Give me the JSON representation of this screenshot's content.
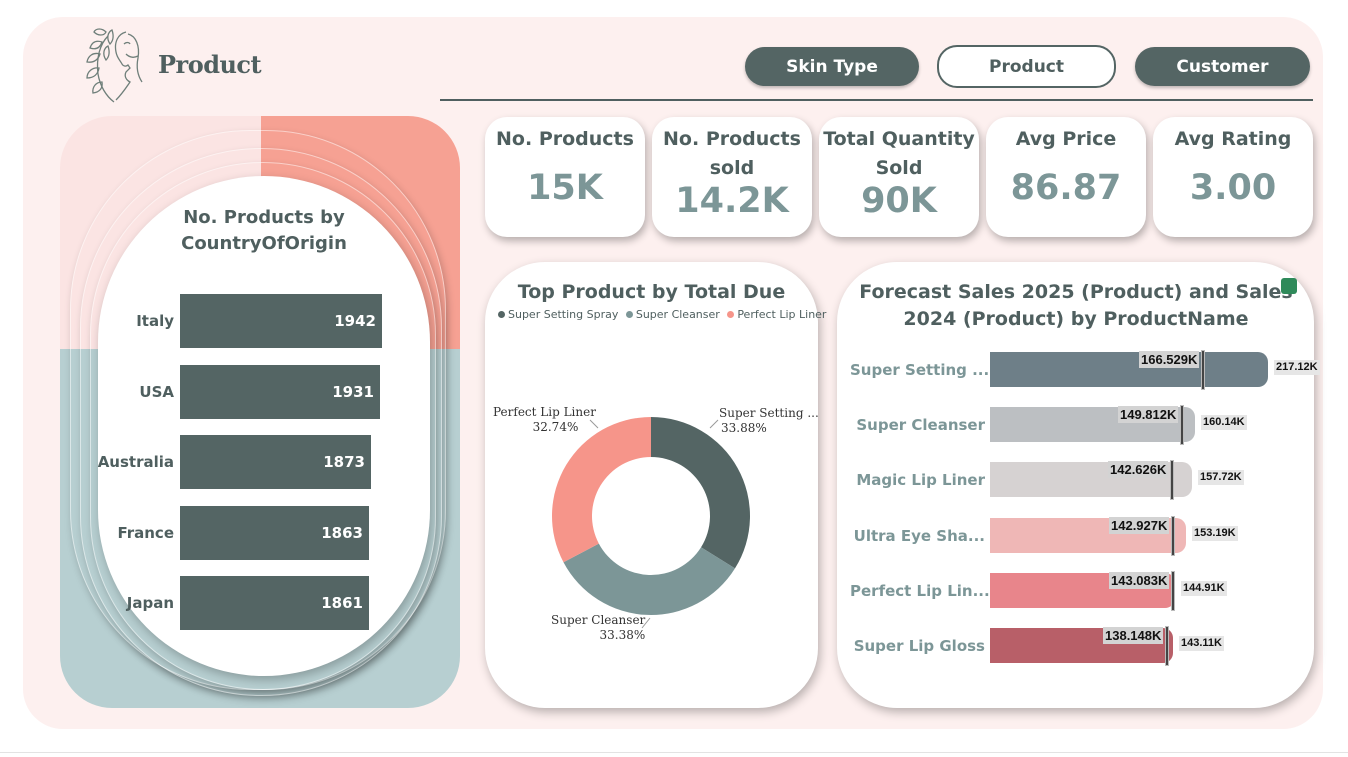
{
  "header": {
    "title": "Product",
    "nav": [
      {
        "label": "Skin Type",
        "active": false
      },
      {
        "label": "Product",
        "active": true
      },
      {
        "label": "Customer",
        "active": false
      }
    ]
  },
  "colors": {
    "dark_teal": "#546564",
    "mid_teal": "#7c9697",
    "salmon": "#f6a193",
    "light_pink": "#fbe4e3",
    "blue_grey": "#b7cfd1",
    "background": "#fdf0ef"
  },
  "kpis": [
    {
      "label": "No. Products",
      "value": "15K"
    },
    {
      "label": "No. Products sold",
      "value": "14.2K"
    },
    {
      "label": "Total Quantity Sold",
      "value": "90K"
    },
    {
      "label": "Avg Price",
      "value": "86.87"
    },
    {
      "label": "Avg Rating",
      "value": "3.00"
    }
  ],
  "country_chart": {
    "title": "No. Products by CountryOfOrigin",
    "xlim": [
      0,
      1942
    ]
  },
  "donut": {
    "title": "Top Product by Total Due",
    "legend": [
      "Super Setting Spray",
      "Super Cleanser",
      "Perfect Lip Liner"
    ],
    "labels": [
      {
        "name": "Super Setting ...",
        "pct": "33.88%"
      },
      {
        "name": "Super Cleanser",
        "pct": "33.38%"
      },
      {
        "name": "Perfect Lip Liner",
        "pct": "32.74%"
      }
    ]
  },
  "forecast": {
    "title": "Forecast Sales 2025 (Product) and Sales 2024 (Product) by ProductName"
  },
  "chart_data": [
    {
      "type": "bar",
      "title": "No. Products by CountryOfOrigin",
      "orientation": "horizontal",
      "categories": [
        "Italy",
        "USA",
        "Australia",
        "France",
        "Japan"
      ],
      "values": [
        1942,
        1931,
        1873,
        1863,
        1861
      ],
      "color": "#546564"
    },
    {
      "type": "pie",
      "donut": true,
      "title": "Top Product by Total Due",
      "categories": [
        "Super Setting Spray",
        "Super Cleanser",
        "Perfect Lip Liner"
      ],
      "values": [
        33.88,
        33.38,
        32.74
      ],
      "colors": [
        "#546564",
        "#7c9697",
        "#f6958a"
      ],
      "legend": "top"
    },
    {
      "type": "bar",
      "orientation": "horizontal",
      "title": "Forecast Sales 2025 (Product) and Sales 2024 (Product) by ProductName",
      "categories": [
        "Super Setting ...",
        "Super Cleanser",
        "Magic Lip Liner",
        "Ultra Eye Sha...",
        "Perfect Lip Lin...",
        "Super Lip Gloss"
      ],
      "series": [
        {
          "values": [
            217.12,
            160.14,
            157.72,
            153.19,
            144.91,
            143.11
          ],
          "labels": [
            "217.12K",
            "160.14K",
            "157.72K",
            "153.19K",
            "144.91K",
            "143.11K"
          ]
        },
        {
          "values": [
            166.529,
            149.812,
            142.626,
            142.927,
            143.083,
            138.148
          ],
          "labels": [
            "166.529K",
            "149.812K",
            "142.626K",
            "142.927K",
            "143.083K",
            "138.148K"
          ]
        }
      ],
      "bar_colors": [
        "#6e7f88",
        "#bcbfc2",
        "#d6d2d2",
        "#efb7b6",
        "#e8858b",
        "#b85f68"
      ]
    }
  ]
}
